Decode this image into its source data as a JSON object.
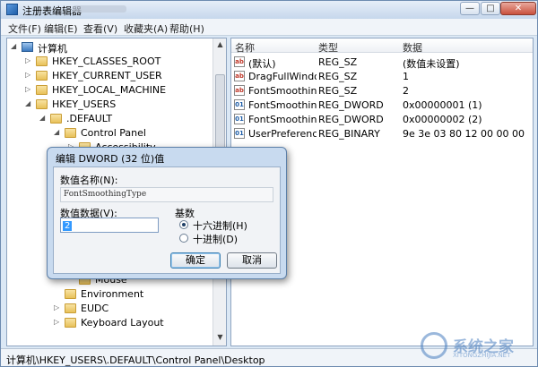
{
  "window": {
    "title": "注册表编辑器",
    "controls": {
      "minimize": "—",
      "maximize": "□",
      "close": "✕"
    }
  },
  "menu": [
    "文件(F)",
    "编辑(E)",
    "查看(V)",
    "收藏夹(A)",
    "帮助(H)"
  ],
  "tree": {
    "root": "计算机",
    "items": [
      "HKEY_CLASSES_ROOT",
      "HKEY_CURRENT_USER",
      "HKEY_LOCAL_MACHINE",
      "HKEY_USERS",
      ".DEFAULT",
      "Control Panel",
      "Accessibility",
      "Mouse",
      "Environment",
      "EUDC",
      "Keyboard Layout"
    ]
  },
  "list": {
    "columns": [
      "名称",
      "类型",
      "数据"
    ],
    "rows": [
      {
        "icon": "string-value-icon",
        "name": "(默认)",
        "type": "REG_SZ",
        "data": "(数值未设置)"
      },
      {
        "icon": "string-value-icon",
        "name": "DragFullWindo...",
        "type": "REG_SZ",
        "data": "1"
      },
      {
        "icon": "string-value-icon",
        "name": "FontSmoothing",
        "type": "REG_SZ",
        "data": "2"
      },
      {
        "icon": "binary-value-icon",
        "name": "FontSmoothin...",
        "type": "REG_DWORD",
        "data": "0x00000001 (1)"
      },
      {
        "icon": "binary-value-icon",
        "name": "FontSmoothin...",
        "type": "REG_DWORD",
        "data": "0x00000002 (2)"
      },
      {
        "icon": "binary-value-icon",
        "name": "UserPreferenc...",
        "type": "REG_BINARY",
        "data": "9e 3e 03 80 12 00 00 00"
      }
    ]
  },
  "status_path": "计算机\\HKEY_USERS\\.DEFAULT\\Control Panel\\Desktop",
  "dialog": {
    "title": "编辑 DWORD (32 位)值",
    "name_label": "数值名称(N):",
    "name_value": "FontSmoothingType",
    "data_label": "数值数据(V):",
    "data_value": "2",
    "base_label": "基数",
    "radio_hex": "十六进制(H)",
    "radio_dec": "十进制(D)",
    "base_selected": "hex",
    "ok": "确定",
    "cancel": "取消"
  },
  "watermark": {
    "text": "系统之家",
    "sub": "XITONGZHIJIA.NET"
  }
}
